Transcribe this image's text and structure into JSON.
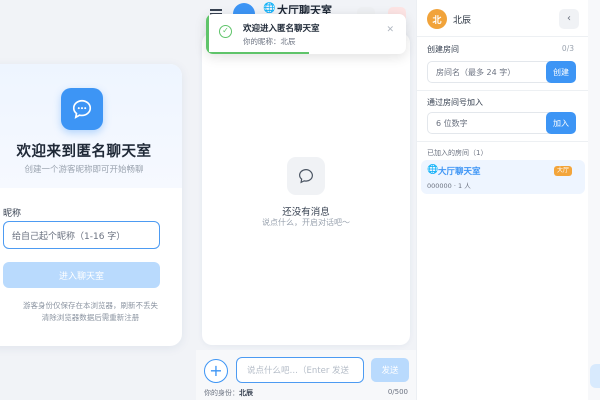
{
  "welcome": {
    "title": "欢迎来到匿名聊天室",
    "subtitle": "创建一个游客昵称即可开始畅聊",
    "nickname_label": "昵称",
    "nickname_placeholder": "给自己起个昵称（1-16 字）",
    "enter_button": "进入聊天室",
    "hint_line1": "游客身份仅保存在本浏览器，刷新不丢失",
    "hint_line2": "清除浏览器数据后需重新注册"
  },
  "chat": {
    "room_icon": "globe-icon",
    "room_title": "大厅聊天室",
    "empty_title": "还没有消息",
    "empty_subtitle": "说点什么，开启对话吧～",
    "input_placeholder": "说点什么吧…（Enter 发送",
    "send_button": "发送",
    "identity_label": "你的身份：",
    "identity_name": "北辰",
    "char_counter": "0/500"
  },
  "toast": {
    "title": "欢迎进入匿名聊天室",
    "message": "你的昵称：北辰",
    "progress": 0.5,
    "color": "#5fc46a"
  },
  "room_panel": {
    "user_avatar_char": "北",
    "user_name": "北辰",
    "collapse_icon": "chevron-left-icon",
    "create_label": "创建房间",
    "create_count": "0/3",
    "create_placeholder": "房间名（最多 24 字）",
    "create_button": "创建",
    "join_label": "通过房间号加入",
    "join_placeholder": "6 位数字",
    "join_button": "加入",
    "joined_label": "已加入的房间（1）",
    "rooms": [
      {
        "name": "大厅聊天室",
        "badge": "大厅",
        "id": "000000",
        "members": "· 1 人"
      }
    ]
  },
  "colors": {
    "accent": "#3d95f5",
    "accent_light": "#b9dafd",
    "success": "#5fc46a",
    "badge": "#f3a53b"
  }
}
